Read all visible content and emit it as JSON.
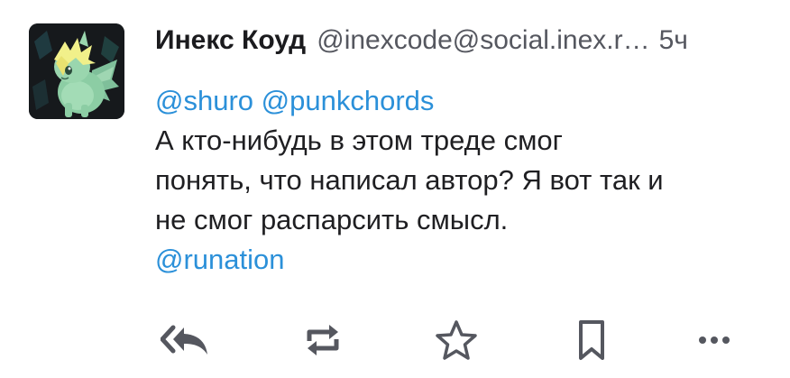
{
  "status": {
    "display_name": "Инекс Коуд",
    "account": "@inexcode@social.inex.r…",
    "timestamp": "5ч",
    "mentions": [
      "@shuro",
      "@punkchords"
    ],
    "body_lines": [
      "А кто-нибудь в этом треде смог",
      "понять, что написал автор? Я вот так и",
      "не смог распарсить смысл."
    ],
    "hashtag_mention": "@runation"
  },
  "actions": {
    "reply_all": "reply-all-icon",
    "boost": "boost-icon",
    "favourite": "star-icon",
    "bookmark": "bookmark-icon",
    "more": "more-icon"
  },
  "colors": {
    "link": "#2b90d9",
    "icon": "#55575f",
    "text": "#1f1f22",
    "avatar_bg": "#16191c"
  }
}
